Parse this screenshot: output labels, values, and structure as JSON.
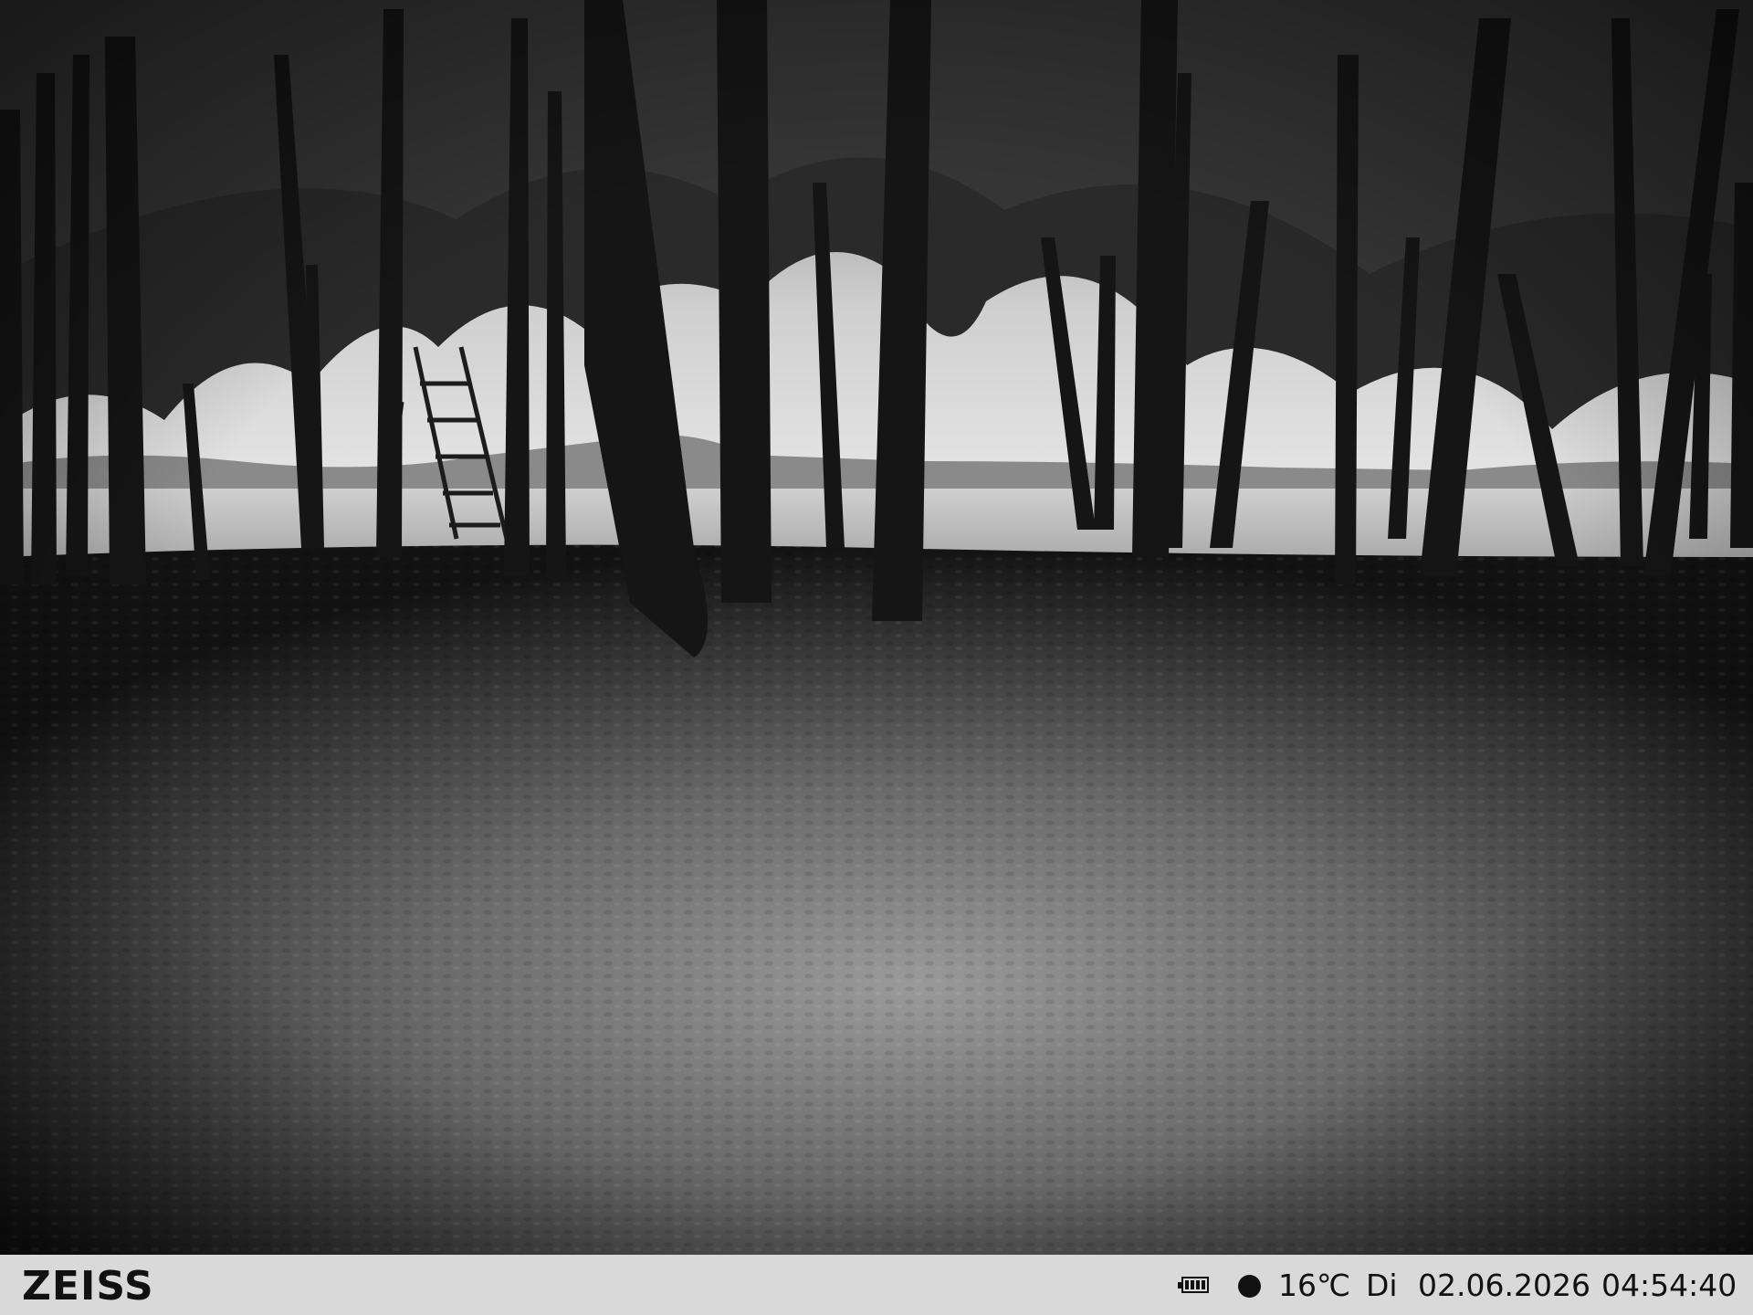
{
  "camera": {
    "brand": "ZEISS",
    "temperature": "16℃",
    "day": "Di",
    "date": "02.06.2026",
    "time": "04:54:40",
    "battery_icon": "battery-full-icon",
    "moon_phase_icon": "full-moon-icon",
    "image_mode": "infrared-night-grayscale",
    "colors": {
      "bar_background": "#d9d9d9",
      "bar_text": "#111111"
    }
  }
}
